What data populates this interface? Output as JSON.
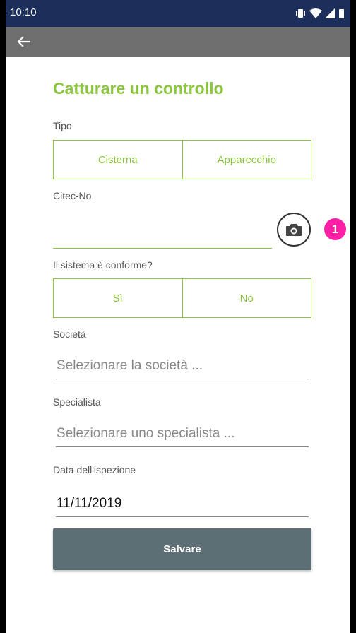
{
  "status_bar": {
    "time": "10:10",
    "icons": [
      "vibrate-icon",
      "wifi-icon",
      "signal-icon",
      "battery-icon"
    ]
  },
  "app_bar": {
    "back_icon": "arrow-left-icon"
  },
  "form": {
    "title": "Catturare un controllo",
    "tipo": {
      "label": "Tipo",
      "options": [
        "Cisterna",
        "Apparecchio"
      ]
    },
    "citec": {
      "label": "Citec-No.",
      "value": "",
      "camera_icon": "camera-icon",
      "badge": "1"
    },
    "conforme": {
      "label": "Il sistema è conforme?",
      "options": [
        "Sì",
        "No"
      ]
    },
    "societa": {
      "label": "Società",
      "placeholder": "Selezionare la società ..."
    },
    "specialista": {
      "label": "Specialista",
      "placeholder": "Selezionare uno specialista ..."
    },
    "data": {
      "label": "Data dell'ispezione",
      "value": "11/11/2019"
    },
    "save_label": "Salvare"
  },
  "colors": {
    "accent": "#8cc63f",
    "status_bar": "#1b2f5a",
    "app_bar": "#6e6e6e",
    "save_button": "#5d6e74",
    "badge": "#ff1fa6"
  }
}
